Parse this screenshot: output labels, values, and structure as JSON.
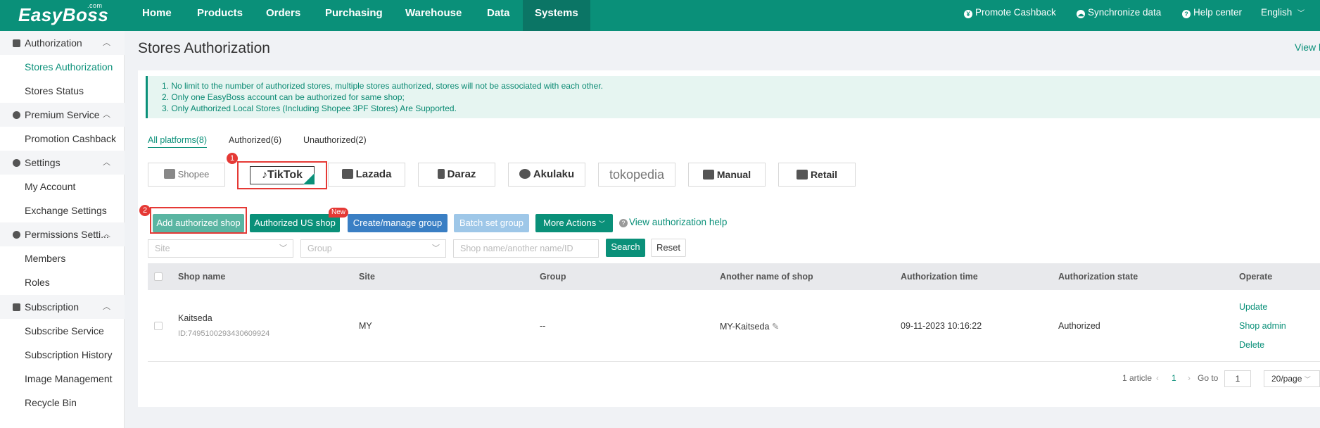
{
  "brand": {
    "name": "EasyBoss",
    "suffix": ".com"
  },
  "nav": {
    "items": [
      {
        "label": "Home"
      },
      {
        "label": "Products"
      },
      {
        "label": "Orders"
      },
      {
        "label": "Purchasing"
      },
      {
        "label": "Warehouse"
      },
      {
        "label": "Data"
      },
      {
        "label": "Systems",
        "active": true
      }
    ],
    "right": {
      "promote": "Promote Cashback",
      "sync": "Synchronize data",
      "help": "Help center",
      "language": "English"
    }
  },
  "sidebar": {
    "sections": [
      {
        "label": "Authorization",
        "icon": "authorization-icon",
        "items": [
          "Stores Authorization",
          "Stores Status"
        ]
      },
      {
        "label": "Premium Service",
        "icon": "premium-icon",
        "items": [
          "Promotion Cashback"
        ]
      },
      {
        "label": "Settings",
        "icon": "gear-icon",
        "items": [
          "My Account",
          "Exchange Settings"
        ]
      },
      {
        "label": "Permissions Setti...",
        "icon": "user-icon",
        "items": [
          "Members",
          "Roles"
        ]
      },
      {
        "label": "Subscription",
        "icon": "subscription-icon",
        "items": [
          "Subscribe Service",
          "Subscription History",
          "Image Management",
          "Recycle Bin"
        ]
      }
    ],
    "active_item": "Stores Authorization"
  },
  "page": {
    "title": "Stores Authorization",
    "view_link": "View l"
  },
  "notice": {
    "lines": [
      "1. No limit to the number of authorized stores, multiple stores authorized, stores will not be associated with each other.",
      "2. Only one EasyBoss account can be authorized for same shop;",
      "3. Only Authorized Local Stores (Including Shopee 3PF Stores) Are Supported."
    ]
  },
  "tabs": [
    {
      "label": "All platforms(8)",
      "active": true
    },
    {
      "label": "Authorized(6)"
    },
    {
      "label": "Unauthorized(2)"
    }
  ],
  "platforms": [
    {
      "label": "Shopee",
      "icon": "shopee-icon"
    },
    {
      "label": "TikTok",
      "icon": "tiktok-icon",
      "selected": true
    },
    {
      "label": "Lazada",
      "icon": "lazada-icon"
    },
    {
      "label": "Daraz",
      "icon": "daraz-icon"
    },
    {
      "label": "Akulaku",
      "icon": "akulaku-icon"
    },
    {
      "label": "tokopedia",
      "icon": "tokopedia-icon"
    },
    {
      "label": "Manual",
      "icon": "store-icon"
    },
    {
      "label": "Retail",
      "icon": "store-icon"
    }
  ],
  "markers": {
    "one": "1",
    "two": "2"
  },
  "actions": {
    "add": "Add authorized shop",
    "us": "Authorized US shop",
    "new_badge": "New",
    "create_group": "Create/manage group",
    "batch": "Batch set group",
    "more": "More Actions",
    "help": "View authorization help",
    "colors": {
      "primary": "#0a9079",
      "blue": "#3a7fc4",
      "disabled": "#9ec7e8"
    }
  },
  "filters": {
    "site_placeholder": "Site",
    "group_placeholder": "Group",
    "search_placeholder": "Shop name/another name/ID",
    "search": "Search",
    "reset": "Reset"
  },
  "table": {
    "columns": [
      "Shop name",
      "Site",
      "Group",
      "Another name of shop",
      "Authorization time",
      "Authorization state",
      "Operate"
    ],
    "rows": [
      {
        "shop_name": "Kaitseda",
        "shop_id": "ID:7495100293430609924",
        "site": "MY",
        "group": "--",
        "another_name": "MY-Kaitseda",
        "auth_time": "09-11-2023 10:16:22",
        "state": "Authorized",
        "ops": [
          "Update",
          "Shop admin",
          "Delete"
        ]
      }
    ]
  },
  "pagination": {
    "total": "1 article",
    "current": "1",
    "goto_label": "Go to",
    "goto_value": "1",
    "page_size": "20/page"
  }
}
